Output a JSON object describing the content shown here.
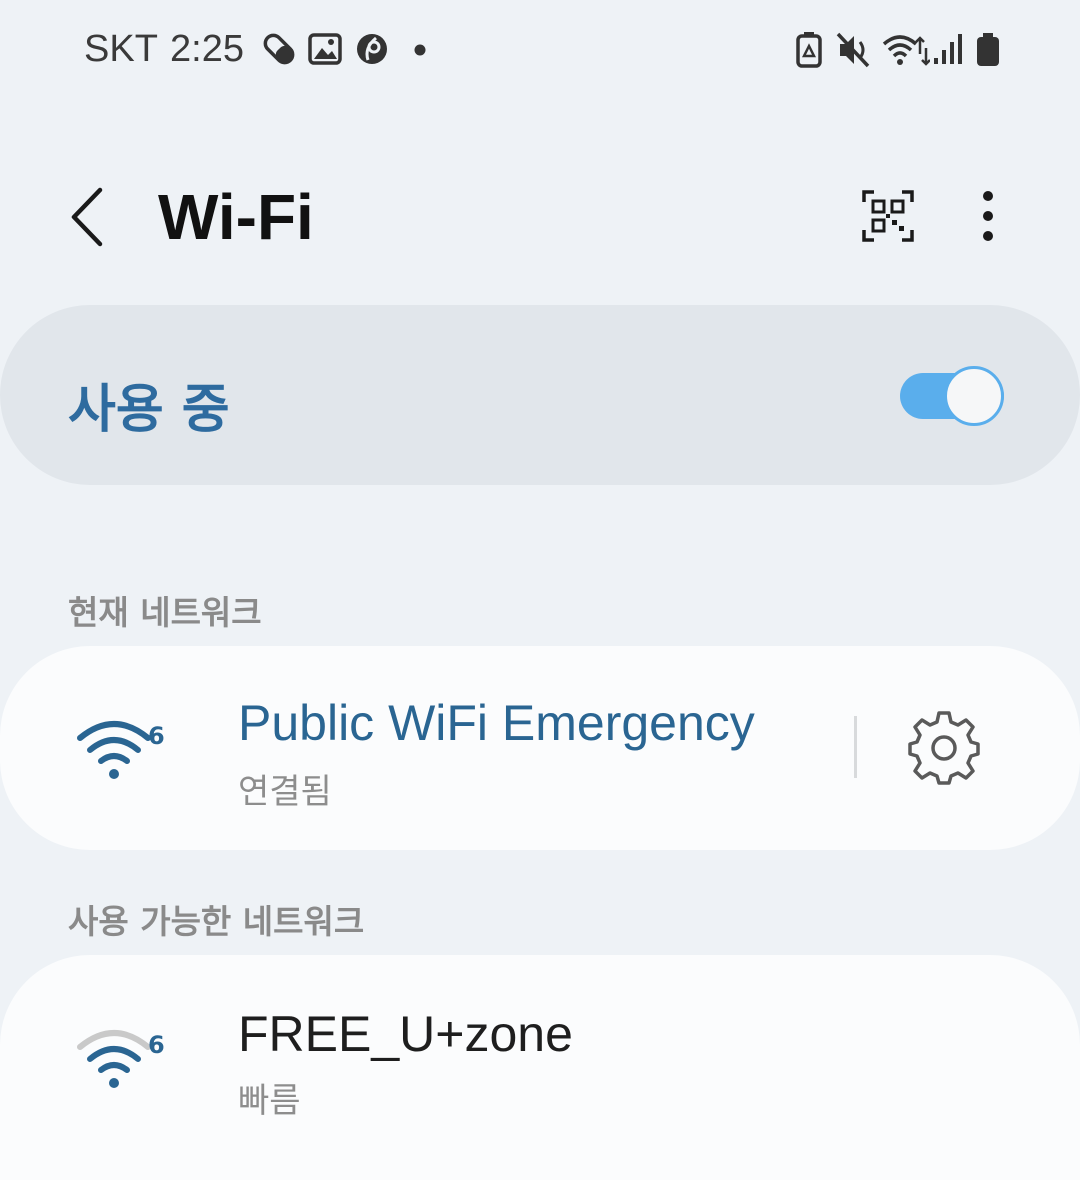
{
  "status_bar": {
    "carrier": "SKT",
    "time": "2:25",
    "left_icons": [
      "pill-icon",
      "gallery-icon",
      "app-notification-icon",
      "more-notifications-dot-icon"
    ],
    "right_icons": [
      "battery-saver-icon",
      "mute-icon",
      "wifi-data-icon",
      "signal-icon",
      "battery-icon"
    ]
  },
  "header": {
    "title": "Wi-Fi",
    "back_icon": "chevron-left-icon",
    "qr_icon": "qr-scan-icon",
    "more_icon": "more-vertical-icon"
  },
  "master_switch": {
    "label": "사용 중",
    "enabled": true,
    "accent_color": "#5aaeec"
  },
  "current_network": {
    "section_label": "현재 네트워크",
    "name": "Public WiFi Emergency",
    "status": "연결됨",
    "wifi_standard": "6",
    "settings_icon": "gear-icon",
    "name_color": "#2a6592"
  },
  "available_networks": {
    "section_label": "사용 가능한 네트워크",
    "items": [
      {
        "name": "FREE_U+zone",
        "status": "빠름",
        "wifi_standard": "6"
      }
    ]
  }
}
